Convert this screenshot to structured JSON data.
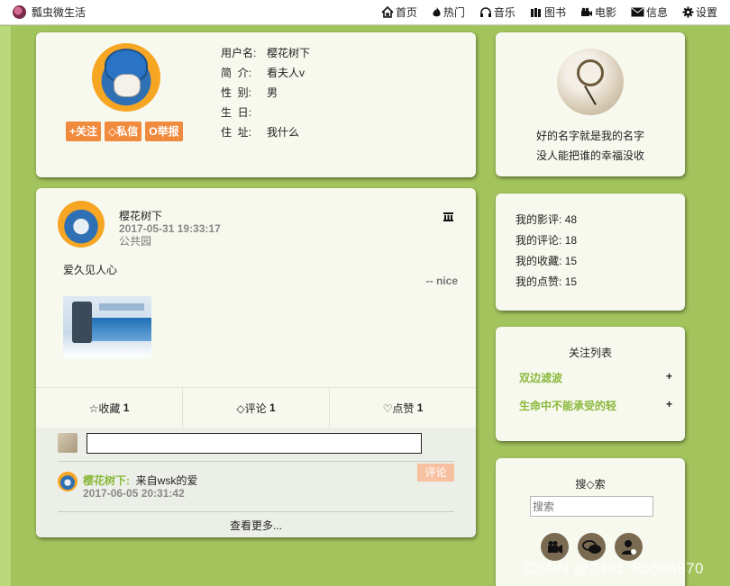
{
  "app": {
    "title": "瓢虫微生活"
  },
  "nav": {
    "items": [
      {
        "label": "首页",
        "icon": "home-icon"
      },
      {
        "label": "热门",
        "icon": "fire-icon"
      },
      {
        "label": "音乐",
        "icon": "headphones-icon"
      },
      {
        "label": "图书",
        "icon": "books-icon"
      },
      {
        "label": "电影",
        "icon": "camera-icon"
      },
      {
        "label": "信息",
        "icon": "envelope-icon"
      },
      {
        "label": "设置",
        "icon": "gear-icon"
      }
    ]
  },
  "profile": {
    "buttons": {
      "follow": "+关注",
      "message": "◇私信",
      "report": "O举报"
    },
    "fields": [
      {
        "label": "用户名:",
        "value": "樱花树下"
      },
      {
        "label": "简  介:",
        "value": "看夫人v"
      },
      {
        "label": "性  别:",
        "value": "男"
      },
      {
        "label": "生  日:",
        "value": ""
      },
      {
        "label": "住  址:",
        "value": "我什么"
      }
    ]
  },
  "post": {
    "author": "樱花树下",
    "time": "2017-05-31 19:33:17",
    "location": "公共园",
    "menu_icon": "III",
    "text": "爱久见人心",
    "signature": "-- nice",
    "actions": {
      "collect_label": "☆收藏",
      "collect_count": "1",
      "comment_label": "◇评论",
      "comment_count": "1",
      "like_label": "♡点赞",
      "like_count": "1"
    }
  },
  "comments": {
    "input_placeholder": "",
    "reply_button": "评论",
    "items": [
      {
        "user": "樱花树下:",
        "text": "来自wsk的爱",
        "time": "2017-06-05 20:31:42"
      }
    ],
    "more": "查看更多..."
  },
  "sidebar": {
    "motto_line1": "好的名字就是我的名字",
    "motto_line2": "没人能把谁的幸福没收",
    "stats": [
      {
        "label": "我的影评:",
        "value": "48"
      },
      {
        "label": "我的评论:",
        "value": "18"
      },
      {
        "label": "我的收藏:",
        "value": "15"
      },
      {
        "label": "我的点赞:",
        "value": "15"
      }
    ],
    "follow_title": "关注列表",
    "follows": [
      {
        "name": "双边滤波",
        "plus": "+"
      },
      {
        "name": "生命中不能承受的轻",
        "plus": "+"
      }
    ],
    "search_title": "搜◇索",
    "search_placeholder": "搜索"
  },
  "watermark": "CSDN @2401_85506870"
}
